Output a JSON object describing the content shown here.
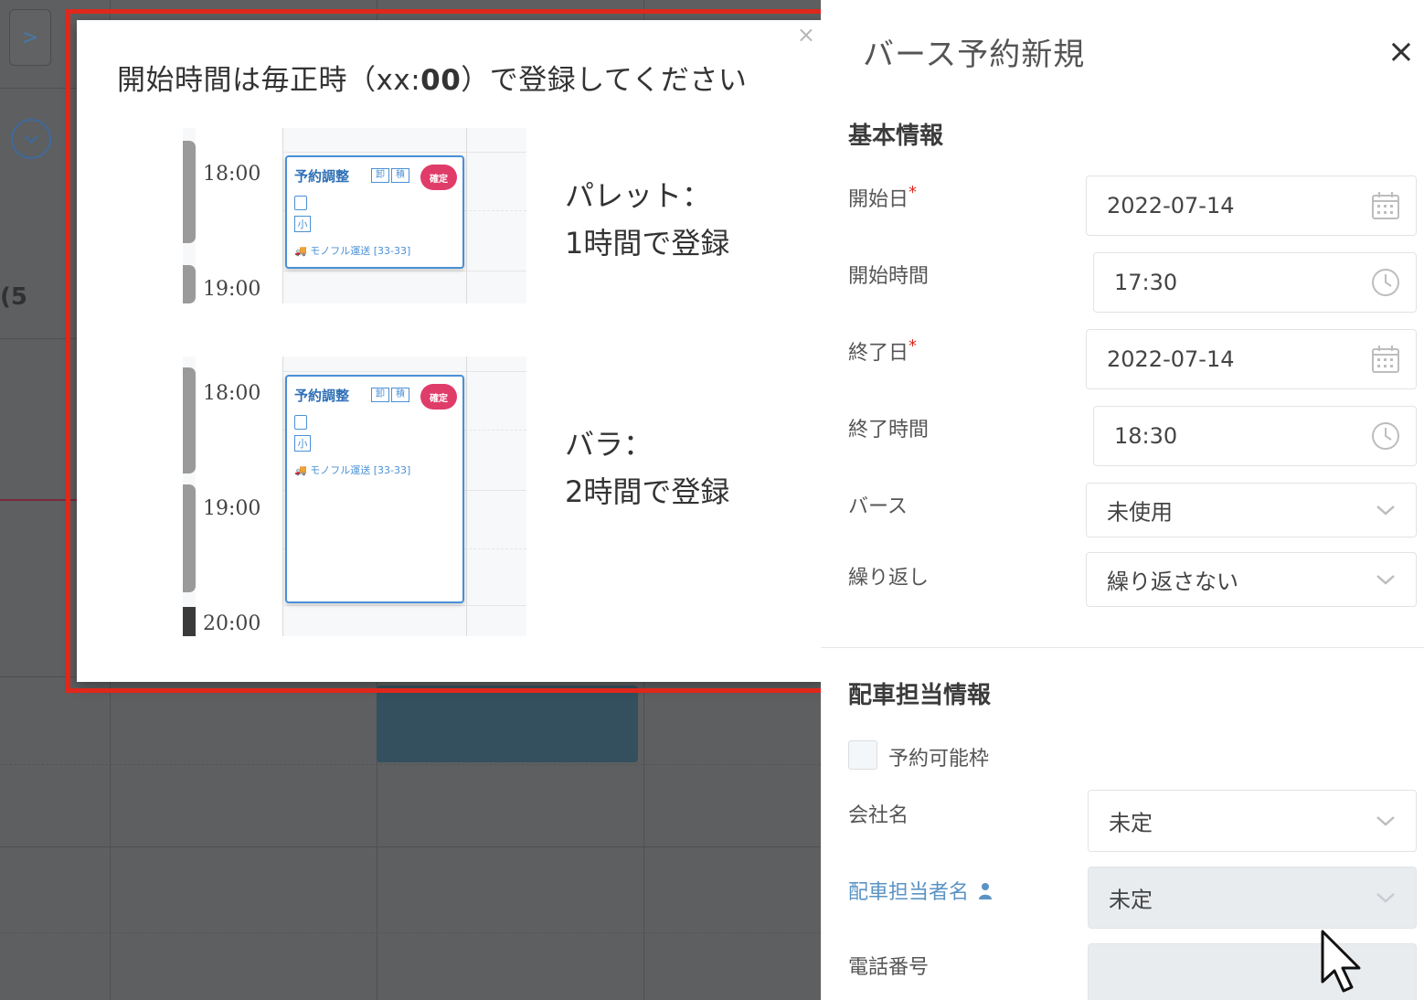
{
  "background": {
    "expand_glyph": ">",
    "count_text": "(5"
  },
  "help_popup": {
    "close_glyph": "×",
    "title_pre": "開始時間は毎正時（xx:",
    "title_bold": "00",
    "title_post": "）で登録してください",
    "samples": [
      {
        "times": [
          "18:00",
          "19:00"
        ],
        "event_title": "予約調整",
        "event_tags": [
          "卸",
          "積"
        ],
        "event_badge": "確定",
        "event_size_tag": "小",
        "event_carrier": "モノフル運送 [33-33]",
        "label_line1": "パレット：",
        "label_line2": "1時間で登録"
      },
      {
        "times": [
          "18:00",
          "19:00",
          "20:00"
        ],
        "event_title": "予約調整",
        "event_tags": [
          "卸",
          "積"
        ],
        "event_badge": "確定",
        "event_size_tag": "小",
        "event_carrier": "モノフル運送 [33-33]",
        "label_line1": "バラ：",
        "label_line2": "2時間で登録"
      }
    ]
  },
  "drawer": {
    "title": "バース予約新規",
    "close_glyph": "×",
    "basic_section": "基本情報",
    "fields": {
      "start_date": {
        "label": "開始日",
        "required_mark": "*",
        "value": "2022-07-14",
        "icon": "calendar-icon"
      },
      "start_time": {
        "label": "開始時間",
        "value": "17:30",
        "icon": "clock-icon"
      },
      "end_date": {
        "label": "終了日",
        "required_mark": "*",
        "value": "2022-07-14",
        "icon": "calendar-icon"
      },
      "end_time": {
        "label": "終了時間",
        "value": "18:30",
        "icon": "clock-icon"
      },
      "berth": {
        "label": "バース",
        "value": "未使用",
        "icon": "chevron-down-icon"
      },
      "repeat": {
        "label": "繰り返し",
        "value": "繰り返さない",
        "icon": "chevron-down-icon"
      }
    },
    "dispatch_section": "配車担当情報",
    "reservable_slot_label": "予約可能枠",
    "company": {
      "label": "会社名",
      "value": "未定"
    },
    "dispatcher": {
      "label": "配車担当者名",
      "value": "未定"
    },
    "phone": {
      "label": "電話番号",
      "value": ""
    }
  },
  "colors": {
    "highlight_border": "#e0271b",
    "event_border": "#4a90d6",
    "badge": "#e03c6a",
    "link_label": "#5a93c4"
  }
}
